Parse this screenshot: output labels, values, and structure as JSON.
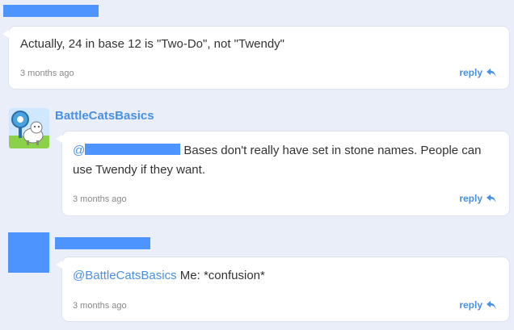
{
  "comments": [
    {
      "text": "Actually, 24 in base 12 is \"Two-Do\", not \"Twendy\"",
      "time": "3 months ago",
      "reply_label": "reply"
    },
    {
      "username": "BattleCatsBasics",
      "mention": "@",
      "text": " Bases don't really have set in stone names. People can use Twendy if they want.",
      "time": "3 months ago",
      "reply_label": "reply"
    },
    {
      "mention": "@BattleCatsBasics",
      "text": " Me: *confusion*",
      "time": "3 months ago",
      "reply_label": "reply"
    }
  ],
  "colors": {
    "accent": "#4a90e2",
    "redaction": "#4d94ff",
    "background": "#e9eef8"
  }
}
